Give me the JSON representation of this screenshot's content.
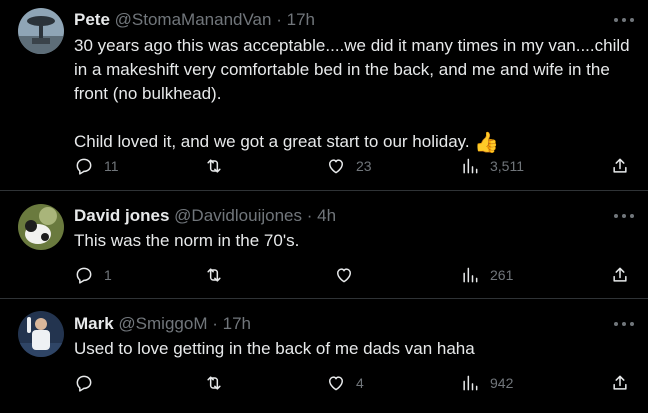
{
  "tweets": [
    {
      "display_name": "Pete",
      "handle": "@StomaManandVan",
      "separator": "·",
      "time": "17h",
      "text_paragraphs": [
        "30 years ago this was acceptable....we did it many times in my van....child in a makeshift very comfortable bed in the back, and me and wife in the front (no bulkhead).",
        "Child loved it, and we got a great start to our holiday."
      ],
      "emoji": "👍",
      "replies": "11",
      "reposts": "",
      "likes": "23",
      "views": "3,511"
    },
    {
      "display_name": "David jones",
      "handle": "@Davidlouijones",
      "separator": "·",
      "time": "4h",
      "text_paragraphs": [
        "This was the norm in the 70's."
      ],
      "replies": "1",
      "reposts": "",
      "likes": "",
      "views": "261"
    },
    {
      "display_name": "Mark",
      "handle": "@SmiggoM",
      "separator": "·",
      "time": "17h",
      "text_paragraphs": [
        "Used to love getting in the back of me dads van haha"
      ],
      "replies": "",
      "reposts": "",
      "likes": "4",
      "views": "942"
    }
  ],
  "icons": {
    "reply": "reply-icon",
    "repost": "repost-icon",
    "like": "like-icon",
    "views": "views-icon",
    "share": "share-icon",
    "more": "more-icon"
  },
  "colors": {
    "background": "#000000",
    "text": "#e7e9ea",
    "secondary": "#71767b",
    "divider": "#2f3336"
  }
}
